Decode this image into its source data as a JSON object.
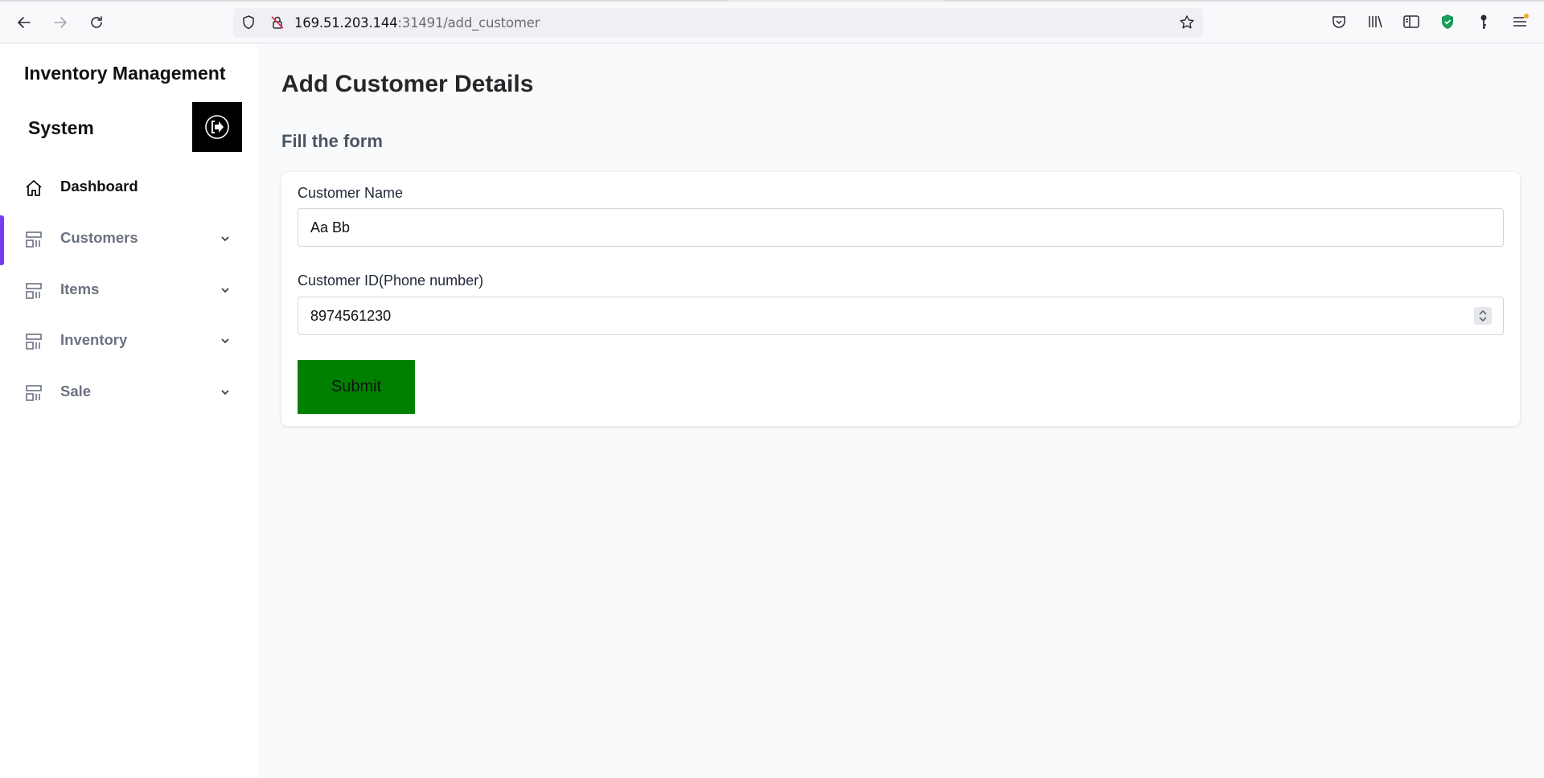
{
  "browser": {
    "url_host": "169.51.203.144",
    "url_rest": ":31491/add_customer"
  },
  "sidebar": {
    "title_line1": "Inventory Management",
    "title_line2": "System",
    "items": [
      {
        "label": "Dashboard",
        "icon": "home-icon",
        "active": true
      },
      {
        "label": "Customers",
        "icon": "layout-icon",
        "expandable": true
      },
      {
        "label": "Items",
        "icon": "layout-icon",
        "expandable": true
      },
      {
        "label": "Inventory",
        "icon": "layout-icon",
        "expandable": true
      },
      {
        "label": "Sale",
        "icon": "layout-icon",
        "expandable": true
      }
    ]
  },
  "main": {
    "title": "Add Customer Details",
    "subtitle": "Fill the form",
    "form": {
      "name_label": "Customer Name",
      "name_value": "Aa Bb",
      "id_label": "Customer ID(Phone number)",
      "id_value": "8974561230",
      "submit_label": "Submit"
    }
  },
  "colors": {
    "submit_bg": "#008000",
    "active_indicator": "#7c3aed",
    "logout_bg": "#000000"
  }
}
